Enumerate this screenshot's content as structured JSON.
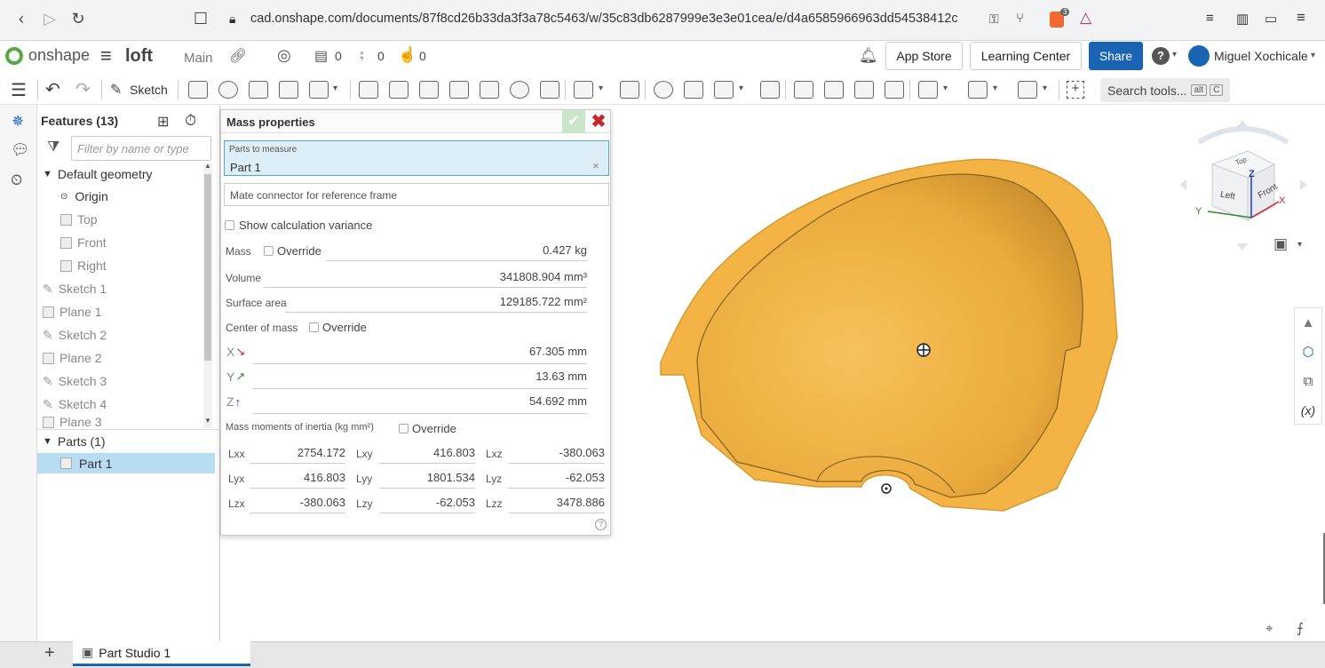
{
  "browser": {
    "url": "cad.onshape.com/documents/87f8cd26b33da3f3a78c5463/w/35c83db6287999e3e3e01cea/e/d4a6585966963dd54538412c",
    "badge_count": "3"
  },
  "header": {
    "brand": "onshape",
    "doc_title": "loft",
    "branch": "Main",
    "count_versions": "0",
    "count_branches": "0",
    "count_likes": "0",
    "app_store": "App Store",
    "learning_center": "Learning Center",
    "share": "Share",
    "help": "?",
    "user_name": "Miguel Xochicale"
  },
  "toolbar": {
    "sketch_label": "Sketch",
    "search_label": "Search tools...",
    "search_key1": "alt",
    "search_key2": "C"
  },
  "features": {
    "title": "Features (13)",
    "filter_placeholder": "Filter by name or type",
    "default_geometry": "Default geometry",
    "items": [
      "Origin",
      "Top",
      "Front",
      "Right",
      "Sketch 1",
      "Plane 1",
      "Sketch 2",
      "Plane 2",
      "Sketch 3",
      "Sketch 4",
      "Plane 3"
    ],
    "parts_title": "Parts (1)",
    "part1": "Part 1"
  },
  "mass": {
    "title": "Mass properties",
    "parts_label": "Parts to measure",
    "parts_value": "Part 1",
    "mate_label": "Mate connector for reference frame",
    "show_variance": "Show calculation variance",
    "mass_label": "Mass",
    "override": "Override",
    "mass_value": "0.427 kg",
    "volume_label": "Volume",
    "volume_value": "341808.904 mm³",
    "surface_label": "Surface area",
    "surface_value": "129185.722 mm²",
    "com_label": "Center of mass",
    "x_label": "X",
    "y_label": "Y",
    "z_label": "Z",
    "x_value": "67.305 mm",
    "y_value": "13.63 mm",
    "z_value": "54.692 mm",
    "moi_label": "Mass moments of inertia (kg mm²)",
    "inertia": [
      [
        {
          "k": "Lxx",
          "v": "2754.172"
        },
        {
          "k": "Lxy",
          "v": "416.803"
        },
        {
          "k": "Lxz",
          "v": "-380.063"
        }
      ],
      [
        {
          "k": "Lyx",
          "v": "416.803"
        },
        {
          "k": "Lyy",
          "v": "1801.534"
        },
        {
          "k": "Lyz",
          "v": "-62.053"
        }
      ],
      [
        {
          "k": "Lzx",
          "v": "-380.063"
        },
        {
          "k": "Lzy",
          "v": "-62.053"
        },
        {
          "k": "Lzz",
          "v": "3478.886"
        }
      ]
    ]
  },
  "viewcube": {
    "top": "Top",
    "left": "Left",
    "front": "Front",
    "x": "X",
    "y": "Y",
    "z": "Z"
  },
  "tabs": {
    "part_studio": "Part Studio 1"
  },
  "colors": {
    "accent": "#1a64b4",
    "part": "#f5b547",
    "selected": "#b8dcf2"
  }
}
